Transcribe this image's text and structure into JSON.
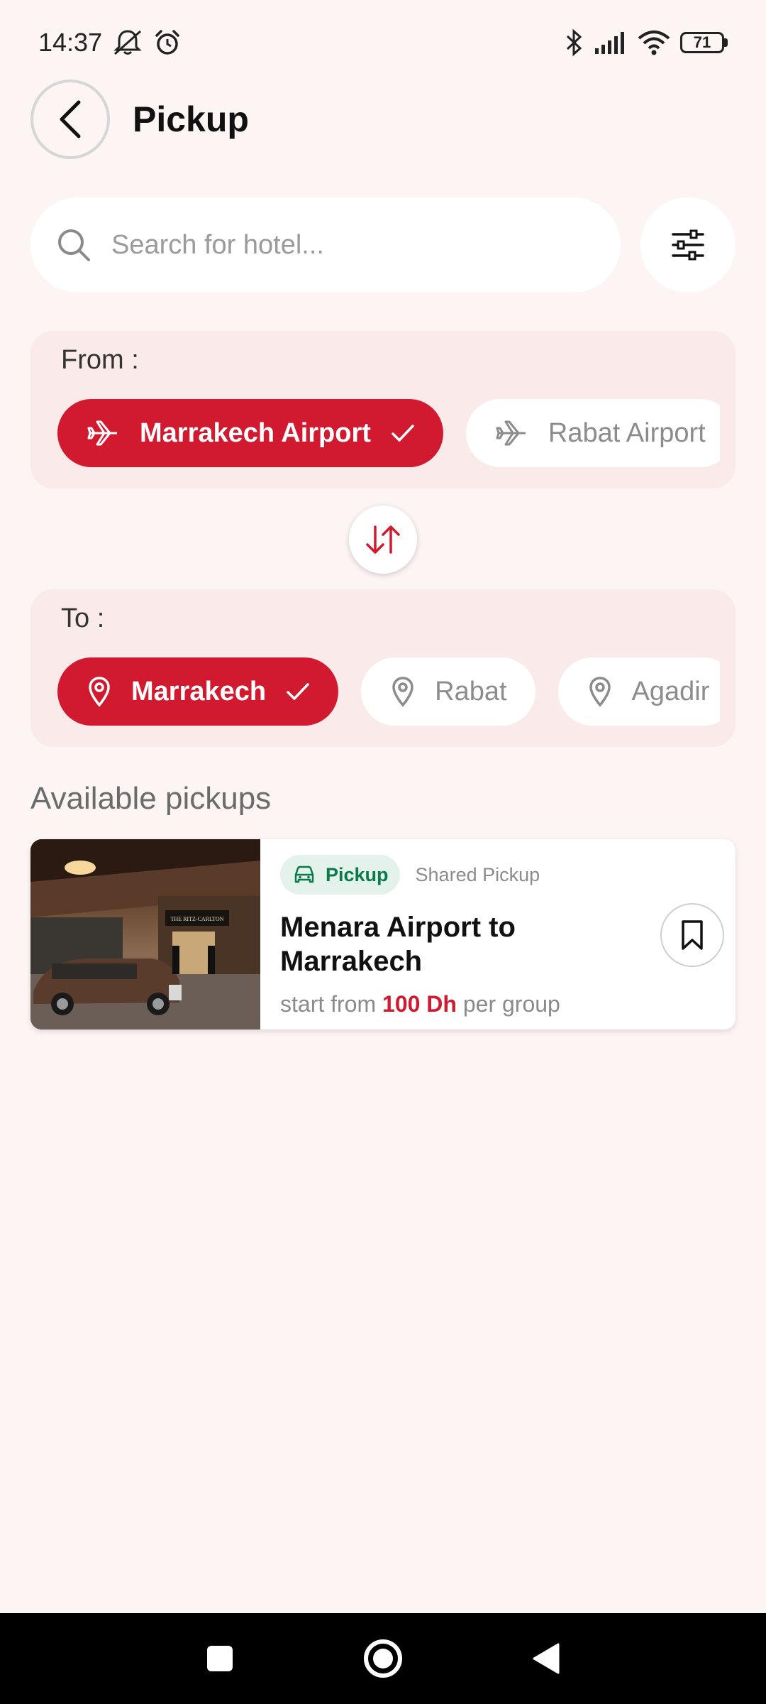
{
  "status_bar": {
    "time": "14:37",
    "battery": "71",
    "icons": [
      "mute-icon",
      "alarm-icon",
      "bluetooth-icon",
      "signal-icon",
      "wifi-icon",
      "battery-icon"
    ]
  },
  "header": {
    "title": "Pickup"
  },
  "search": {
    "placeholder": "Search for hotel..."
  },
  "from_panel": {
    "label": "From :",
    "options": [
      {
        "label": "Marrakech Airport",
        "selected": true,
        "icon": "plane-icon"
      },
      {
        "label": "Rabat Airport",
        "selected": false,
        "icon": "plane-icon"
      }
    ]
  },
  "to_panel": {
    "label": "To :",
    "options": [
      {
        "label": "Marrakech",
        "selected": true,
        "icon": "location-pin-icon"
      },
      {
        "label": "Rabat",
        "selected": false,
        "icon": "location-pin-icon"
      },
      {
        "label": "Agadir",
        "selected": false,
        "icon": "location-pin-icon"
      }
    ]
  },
  "section": {
    "title": "Available pickups"
  },
  "pickups": [
    {
      "tag": "Pickup",
      "type": "Shared Pickup",
      "title": "Menara Airport to Marrakech",
      "price_prefix": "start from ",
      "price": "100 Dh",
      "price_suffix": " per group",
      "image_sign": "THE RITZ-CARLTON"
    }
  ],
  "colors": {
    "accent": "#d11a2f",
    "background": "#fdf4f4",
    "panel": "#faeaea",
    "tag_green": "#0b7a4b"
  }
}
